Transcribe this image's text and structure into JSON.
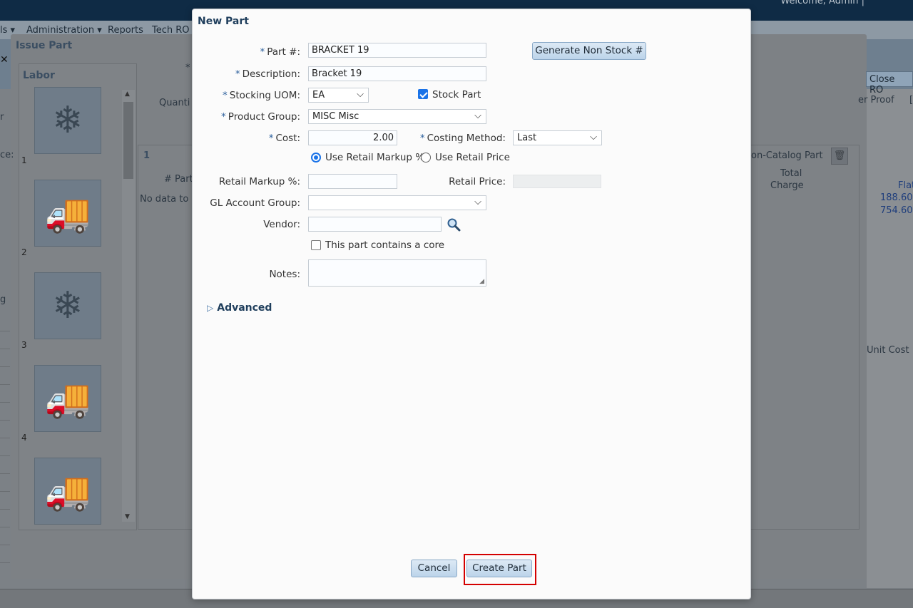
{
  "app": {
    "welcome_text": "Welcome, Admin  |",
    "menu": [
      "ls ▾",
      "Administration ▾",
      "Reports",
      "Tech RO"
    ],
    "issue_panel_title": "Issue Part",
    "labor_title": "Labor",
    "labor_tiles": [
      {
        "num": "1",
        "icon": "hvac-icon"
      },
      {
        "num": "2",
        "icon": "service-truck-icon"
      },
      {
        "num": "3",
        "icon": "hvac-icon"
      },
      {
        "num": "4",
        "icon": "service-truck-icon"
      },
      {
        "num": "",
        "icon": "service-truck-icon"
      }
    ],
    "close_ro_label": "Close RO",
    "bg_texts": {
      "quantity": "Quanti",
      "asterisk": "*",
      "row_num": "1",
      "col_hash": "#",
      "col_part": "Part",
      "no_data": "No data to d",
      "non_catalog": "on-Catalog Part",
      "total_charge_1": "Total",
      "total_charge_2": "Charge",
      "proof": "er Proof",
      "bracket": "[",
      "flat": "Flat",
      "val1": "188.60",
      "val2": "754.60",
      "unit_cost": "Unit Cost",
      "left_r": "r",
      "left_ce": "ce:",
      "left_g": "g"
    }
  },
  "modal": {
    "title": "New Part",
    "part_no": {
      "label": "Part #:",
      "value": "BRACKET 19"
    },
    "generate_btn": "Generate Non Stock #",
    "description": {
      "label": "Description:",
      "value": "Bracket 19"
    },
    "stocking_uom": {
      "label": "Stocking UOM:",
      "value": "EA"
    },
    "stock_part": {
      "label": "Stock Part",
      "checked": true
    },
    "product_group": {
      "label": "Product Group:",
      "value": "MISC Misc"
    },
    "cost": {
      "label": "Cost:",
      "value": "2.00"
    },
    "costing_method": {
      "label": "Costing Method:",
      "value": "Last"
    },
    "pricing_options": [
      {
        "label": "Use Retail Markup %",
        "selected": true
      },
      {
        "label": "Use Retail Price",
        "selected": false
      }
    ],
    "retail_markup": {
      "label": "Retail Markup %:",
      "value": ""
    },
    "retail_price": {
      "label": "Retail Price:",
      "value": ""
    },
    "gl_account_group": {
      "label": "GL Account Group:",
      "value": ""
    },
    "vendor": {
      "label": "Vendor:",
      "value": ""
    },
    "core": {
      "label": "This part contains a core",
      "checked": false
    },
    "notes": {
      "label": "Notes:",
      "value": ""
    },
    "advanced_label": "Advanced",
    "cancel_btn": "Cancel",
    "create_btn": "Create Part",
    "required_marker": "*"
  }
}
